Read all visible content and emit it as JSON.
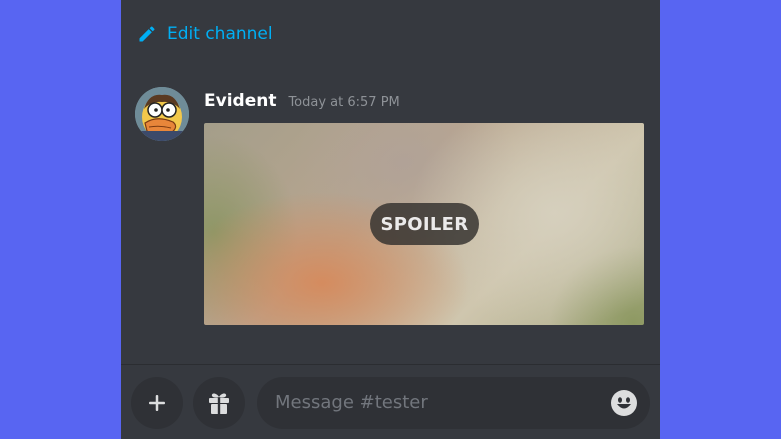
{
  "header": {
    "edit_channel_label": "Edit channel",
    "edit_icon": "pencil-icon"
  },
  "message": {
    "username": "Evident",
    "timestamp": "Today at 6:57 PM",
    "attachment": {
      "spoiler_label": "SPOILER"
    }
  },
  "composer": {
    "placeholder": "Message #tester",
    "icons": {
      "add": "plus-icon",
      "gift": "gift-icon",
      "emoji": "emoji-icon"
    }
  },
  "colors": {
    "background": "#5865f2",
    "chat_background": "#36393f",
    "link": "#00aff4",
    "input_background": "#2f3136",
    "timestamp": "#8e9297"
  }
}
